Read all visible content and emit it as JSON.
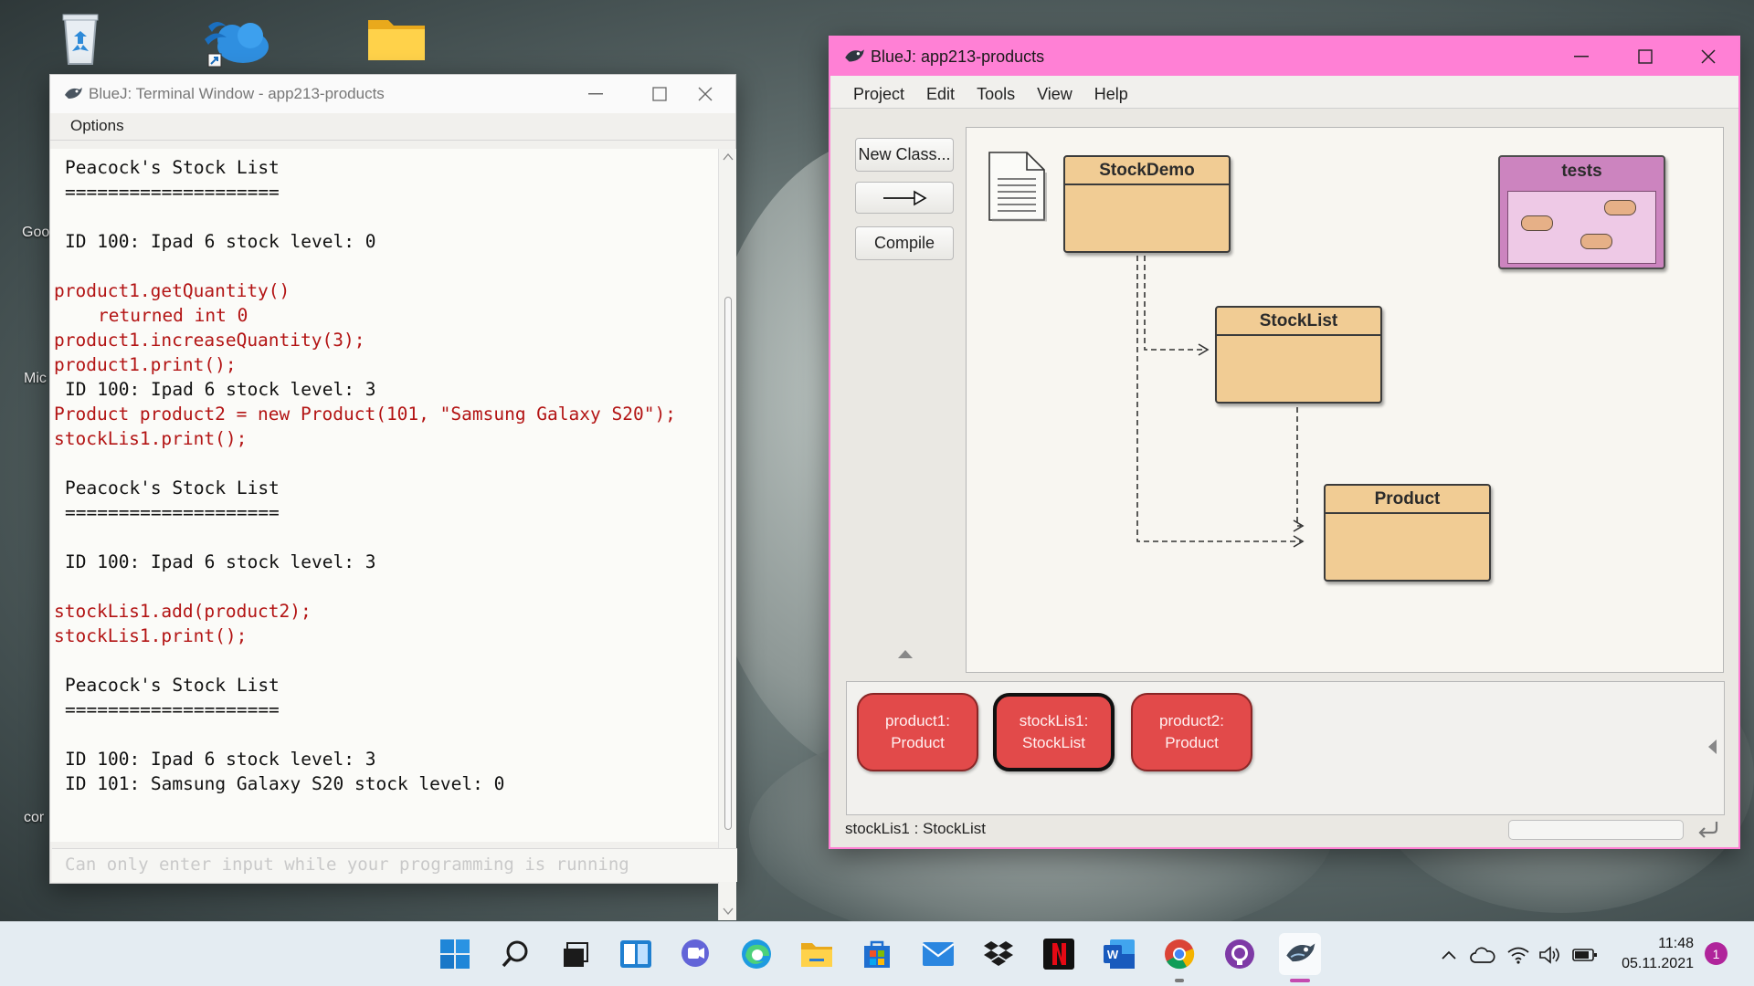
{
  "desktop": {
    "labels": [
      "Goo",
      "Mic",
      "cor"
    ]
  },
  "terminal": {
    "title": "BlueJ: Terminal Window - app213-products",
    "menu_options": "Options",
    "lines": [
      {
        "type": "out",
        "text": "Peacock's Stock List"
      },
      {
        "type": "out",
        "text": "===================="
      },
      {
        "type": "out",
        "text": ""
      },
      {
        "type": "out",
        "text": "ID 100: Ipad 6 stock level: 0"
      },
      {
        "type": "out",
        "text": ""
      },
      {
        "type": "call",
        "text": "product1.getQuantity()"
      },
      {
        "type": "ind",
        "text": "returned int 0"
      },
      {
        "type": "call",
        "text": "product1.increaseQuantity(3);"
      },
      {
        "type": "call",
        "text": "product1.print();"
      },
      {
        "type": "out",
        "text": "ID 100: Ipad 6 stock level: 3"
      },
      {
        "type": "call",
        "text": "Product product2 = new Product(101, \"Samsung Galaxy S20\");"
      },
      {
        "type": "call",
        "text": "stockLis1.print();"
      },
      {
        "type": "out",
        "text": ""
      },
      {
        "type": "out",
        "text": "Peacock's Stock List"
      },
      {
        "type": "out",
        "text": "===================="
      },
      {
        "type": "out",
        "text": ""
      },
      {
        "type": "out",
        "text": "ID 100: Ipad 6 stock level: 3"
      },
      {
        "type": "out",
        "text": ""
      },
      {
        "type": "call",
        "text": "stockLis1.add(product2);"
      },
      {
        "type": "call",
        "text": "stockLis1.print();"
      },
      {
        "type": "out",
        "text": ""
      },
      {
        "type": "out",
        "text": "Peacock's Stock List"
      },
      {
        "type": "out",
        "text": "===================="
      },
      {
        "type": "out",
        "text": ""
      },
      {
        "type": "out",
        "text": "ID 100: Ipad 6 stock level: 3"
      },
      {
        "type": "out",
        "text": "ID 101: Samsung Galaxy S20 stock level: 0"
      }
    ],
    "input_placeholder": "Can only enter input while your programming is running"
  },
  "bluej": {
    "title": "BlueJ:  app213-products",
    "menu": [
      "Project",
      "Edit",
      "Tools",
      "View",
      "Help"
    ],
    "buttons": {
      "new_class": "New Class...",
      "compile": "Compile"
    },
    "classes": {
      "stockdemo": "StockDemo",
      "stocklist": "StockList",
      "product": "Product",
      "tests": "tests"
    },
    "objects": [
      {
        "line1": "product1:",
        "line2": "Product",
        "selected": false
      },
      {
        "line1": "stockLis1:",
        "line2": "StockList",
        "selected": true
      },
      {
        "line1": "product2:",
        "line2": "Product",
        "selected": false
      }
    ],
    "status": "stockLis1 : StockList"
  },
  "taskbar": {
    "time": "11:48",
    "date": "05.11.2021",
    "notification_count": "1"
  },
  "colors": {
    "bluej_title_accent": "#ff80d5",
    "class_fill": "#f1cc94",
    "object_fill": "#e24a4a",
    "terminal_call_text": "#b31414"
  }
}
